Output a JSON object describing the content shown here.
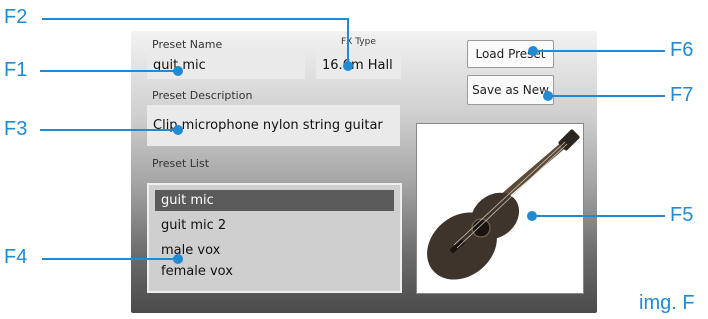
{
  "preset": {
    "name_label": "Preset Name",
    "name_value": "guit mic",
    "fx_label": "FX Type",
    "fx_value": "16.6m Hall",
    "desc_label": "Preset Description",
    "desc_value": "Clip microphone nylon string guitar",
    "list_label": "Preset List",
    "list_items": [
      "guit mic",
      "guit mic 2",
      "male vox",
      "female vox"
    ],
    "selected_index": 0
  },
  "buttons": {
    "load": "Load Preset",
    "save_new": "Save as New"
  },
  "image": {
    "subject": "acoustic-guitar"
  },
  "callouts": {
    "f1": "F1",
    "f2": "F2",
    "f3": "F3",
    "f4": "F4",
    "f5": "F5",
    "f6": "F6",
    "f7": "F7"
  },
  "figure_label": "img. F",
  "colors": {
    "callout": "#1f8bd4",
    "selected": "#5a5a5a"
  }
}
